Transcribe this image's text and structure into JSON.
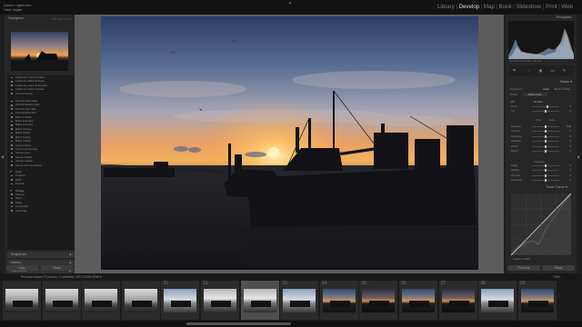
{
  "app": {
    "logo_line1": "Adobe Lightroom",
    "logo_line2": "Hanh Ngan"
  },
  "modules": [
    "Library",
    "Develop",
    "Map",
    "Book",
    "Slideshow",
    "Print",
    "Web"
  ],
  "active_module": "Develop",
  "left_panel": {
    "navigator": "Navigator",
    "nav_modes": "FIT  FILL  1:1  3:1",
    "presets": [
      {
        "label": "Lightroom Color Creative",
        "type": "item"
      },
      {
        "label": "Lightroom Effect Presets",
        "type": "item"
      },
      {
        "label": "Lightroom General Presets",
        "type": "item"
      },
      {
        "label": "Lightroom Video Presets",
        "type": "item"
      },
      {
        "label": "Portrait Preset",
        "type": "item"
      },
      {
        "label": "Portrait Clean Skin",
        "type": "gap"
      },
      {
        "label": "Portrait Medium Skin",
        "type": "item"
      },
      {
        "label": "Portrait Light Skin",
        "type": "item"
      },
      {
        "label": "Portrait Dark Skin",
        "type": "item"
      },
      {
        "label": "Black & White",
        "type": "item"
      },
      {
        "label": "Black Dramatic",
        "type": "item"
      },
      {
        "label": "Black Contrast",
        "type": "item"
      },
      {
        "label": "Black Vintage",
        "type": "item"
      },
      {
        "label": "Black Subtle",
        "type": "item"
      },
      {
        "label": "Black Toning",
        "type": "item"
      },
      {
        "label": "Black Classic",
        "type": "item"
      },
      {
        "label": "Sunset Warm",
        "type": "item"
      },
      {
        "label": "Sunset Landscape",
        "type": "item"
      },
      {
        "label": "Sunset Cool",
        "type": "item"
      },
      {
        "label": "Sunset Faded",
        "type": "item"
      },
      {
        "label": "Sunset Golden",
        "type": "item"
      },
      {
        "label": "Sunset Film Emulation",
        "type": "item"
      },
      {
        "label": "Color",
        "type": "folder"
      },
      {
        "label": "Creative",
        "type": "item"
      },
      {
        "label": "B&W",
        "type": "item"
      },
      {
        "label": "Portrait",
        "type": "item"
      },
      {
        "label": "Vintage",
        "type": "folder"
      },
      {
        "label": "Cinema",
        "type": "item"
      },
      {
        "label": "Warm",
        "type": "item"
      },
      {
        "label": "Matte",
        "type": "item"
      },
      {
        "label": "Landscape",
        "type": "item"
      },
      {
        "label": "Sparkling",
        "type": "item"
      }
    ],
    "snapshots": "Snapshots",
    "history": "History",
    "collections": "Collections",
    "copy": "Copy...",
    "paste": "Paste"
  },
  "right_panel": {
    "histogram": "Histogram",
    "exif": "ISO 100   28 mm   f/8.0   1/60 sec",
    "basic": "Basic",
    "treatment_label": "Treatment:",
    "treatment_color": "Color",
    "treatment_bw": "Black & White",
    "profile_label": "Profile:",
    "profile_value": "Adobe Color",
    "wb_label": "WB:",
    "wb_value": "As Shot",
    "tone_label": "Tone",
    "tone_auto": "Auto",
    "presence_label": "Presence",
    "sliders": [
      {
        "name": "Temp",
        "value": "0",
        "pos": 0.55
      },
      {
        "name": "Tint",
        "value": "0",
        "pos": 0.5
      },
      {
        "name": "Exposure",
        "value": "0.00",
        "pos": 0.5
      },
      {
        "name": "Contrast",
        "value": "0",
        "pos": 0.5
      },
      {
        "name": "Highlights",
        "value": "0",
        "pos": 0.5
      },
      {
        "name": "Shadows",
        "value": "0",
        "pos": 0.5
      },
      {
        "name": "Whites",
        "value": "0",
        "pos": 0.5
      },
      {
        "name": "Blacks",
        "value": "0",
        "pos": 0.5
      },
      {
        "name": "Clarity",
        "value": "0",
        "pos": 0.5
      },
      {
        "name": "Dehaze",
        "value": "0",
        "pos": 0.5
      },
      {
        "name": "Vibrance",
        "value": "0",
        "pos": 0.5
      },
      {
        "name": "Saturation",
        "value": "0",
        "pos": 0.5
      }
    ],
    "tone_curve": "Tone Curve",
    "channel": "Channel:   RGB   ↕",
    "hsl": "HSL / Color",
    "previous": "Previous",
    "reset": "Reset"
  },
  "filmstrip": {
    "info": "Previous Import   37 photos / 1 selected / DSC00448.ARW ▾",
    "filter": "Filter :",
    "cells": [
      {
        "num": "",
        "style": "mono",
        "selected": false
      },
      {
        "num": "",
        "style": "mono",
        "selected": false
      },
      {
        "num": "",
        "style": "mono",
        "selected": false
      },
      {
        "num": "",
        "style": "mono",
        "selected": false
      },
      {
        "num": "30",
        "style": "day",
        "selected": false
      },
      {
        "num": "31",
        "style": "grey",
        "selected": false
      },
      {
        "num": "32",
        "style": "grey",
        "selected": true
      },
      {
        "num": "33",
        "style": "day",
        "selected": false
      },
      {
        "num": "34",
        "style": "dusk",
        "selected": false
      },
      {
        "num": "35",
        "style": "dusk2",
        "selected": false
      },
      {
        "num": "36",
        "style": "dusk",
        "selected": false
      },
      {
        "num": "37",
        "style": "dusk2",
        "selected": false
      },
      {
        "num": "38",
        "style": "day",
        "selected": false
      },
      {
        "num": "39",
        "style": "dusk",
        "selected": false
      }
    ]
  }
}
